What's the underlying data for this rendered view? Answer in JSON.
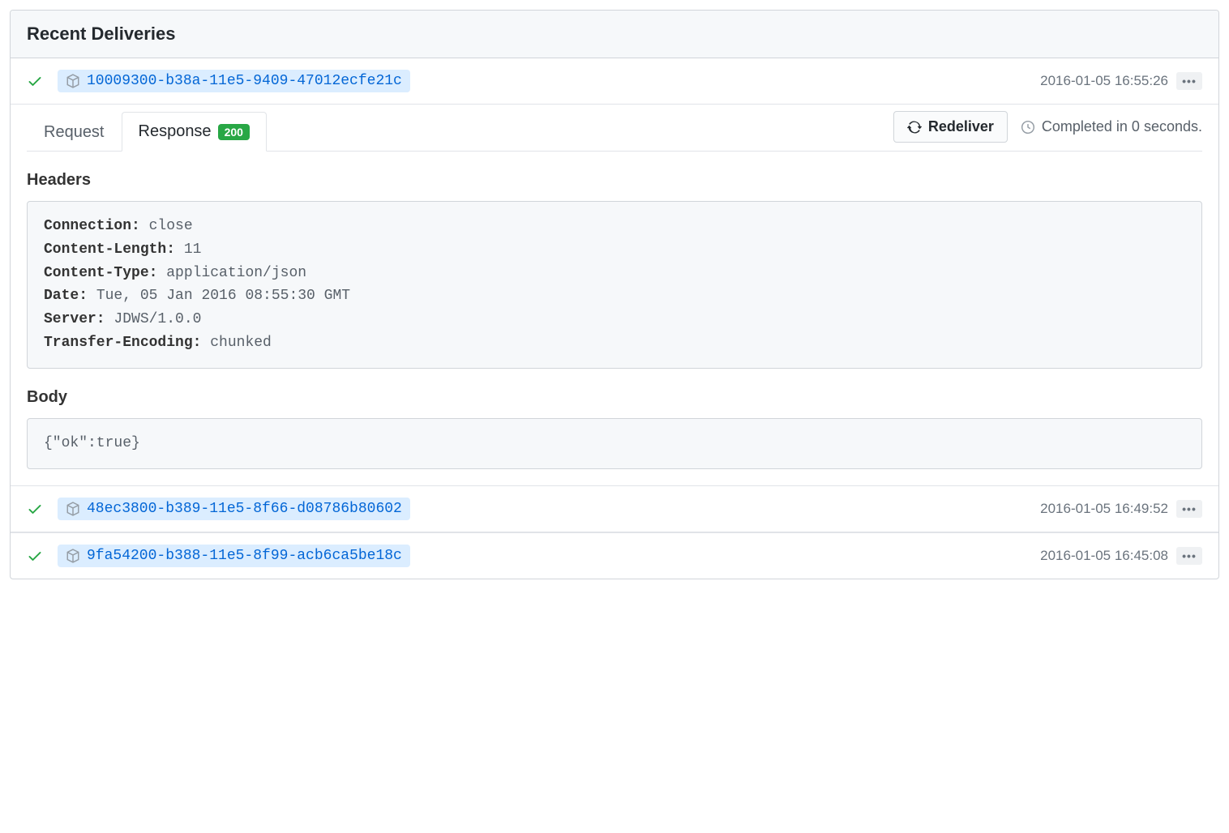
{
  "panel": {
    "title": "Recent Deliveries"
  },
  "deliveries": [
    {
      "id": "10009300-b38a-11e5-9409-47012ecfe21c",
      "timestamp": "2016-01-05 16:55:26",
      "expanded": true
    },
    {
      "id": "48ec3800-b389-11e5-8f66-d08786b80602",
      "timestamp": "2016-01-05 16:49:52",
      "expanded": false
    },
    {
      "id": "9fa54200-b388-11e5-8f99-acb6ca5be18c",
      "timestamp": "2016-01-05 16:45:08",
      "expanded": false
    }
  ],
  "tabs": {
    "request": "Request",
    "response": "Response",
    "status_code": "200"
  },
  "actions": {
    "redeliver": "Redeliver",
    "completed_text": "Completed in 0 seconds."
  },
  "response_detail": {
    "headers_label": "Headers",
    "headers": [
      {
        "key": "Connection:",
        "value": " close"
      },
      {
        "key": "Content-Length:",
        "value": " 11"
      },
      {
        "key": "Content-Type:",
        "value": " application/json"
      },
      {
        "key": "Date:",
        "value": " Tue, 05 Jan 2016 08:55:30 GMT"
      },
      {
        "key": "Server:",
        "value": " JDWS/1.0.0"
      },
      {
        "key": "Transfer-Encoding:",
        "value": " chunked"
      }
    ],
    "body_label": "Body",
    "body": "{\"ok\":true}"
  }
}
